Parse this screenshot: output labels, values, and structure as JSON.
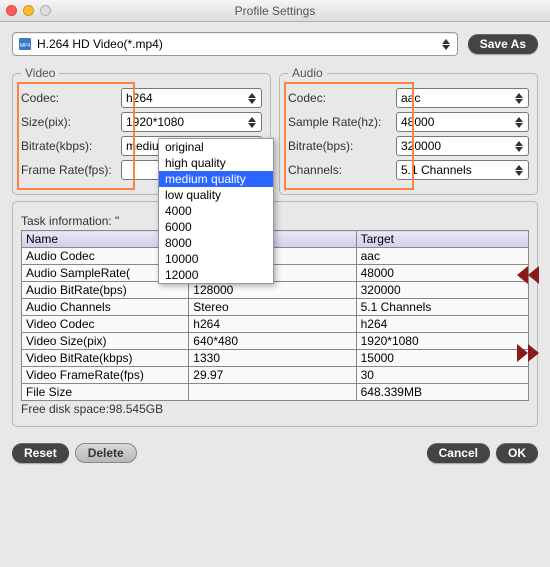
{
  "titlebar": {
    "title": "Profile Settings"
  },
  "profile": {
    "name": "H.264 HD Video(*.mp4)"
  },
  "buttons": {
    "save_as": "Save As",
    "reset": "Reset",
    "delete": "Delete",
    "cancel": "Cancel",
    "ok": "OK"
  },
  "video": {
    "legend": "Video",
    "codec_label": "Codec:",
    "codec_value": "h264",
    "size_label": "Size(pix):",
    "size_value": "1920*1080",
    "bitrate_label": "Bitrate(kbps):",
    "bitrate_value": "medium quality",
    "framerate_label": "Frame Rate(fps):",
    "framerate_value": ""
  },
  "audio": {
    "legend": "Audio",
    "codec_label": "Codec:",
    "codec_value": "aac",
    "samplerate_label": "Sample Rate(hz):",
    "samplerate_value": "48000",
    "bitrate_label": "Bitrate(bps):",
    "bitrate_value": "320000",
    "channels_label": "Channels:",
    "channels_value": "5.1 Channels"
  },
  "bitrate_dropdown": {
    "options": [
      "original",
      "high quality",
      "medium quality",
      "low quality",
      "4000",
      "6000",
      "8000",
      "10000",
      "12000"
    ],
    "selected": "medium quality"
  },
  "task": {
    "caption": "Task information: \"",
    "col_name": "Name",
    "col_target": "Target",
    "rows": [
      {
        "name": "Audio Codec",
        "src": "",
        "tgt": "aac"
      },
      {
        "name": "Audio SampleRate(",
        "src": "",
        "tgt": "48000"
      },
      {
        "name": "Audio BitRate(bps)",
        "src": "128000",
        "tgt": "320000"
      },
      {
        "name": "Audio Channels",
        "src": "Stereo",
        "tgt": "5.1 Channels"
      },
      {
        "name": "Video Codec",
        "src": "h264",
        "tgt": "h264"
      },
      {
        "name": "Video Size(pix)",
        "src": "640*480",
        "tgt": "1920*1080"
      },
      {
        "name": "Video BitRate(kbps)",
        "src": "1330",
        "tgt": "15000"
      },
      {
        "name": "Video FrameRate(fps)",
        "src": "29.97",
        "tgt": "30"
      },
      {
        "name": "File Size",
        "src": "",
        "tgt": "648.339MB"
      }
    ],
    "free_space": "Free disk space:98.545GB"
  }
}
